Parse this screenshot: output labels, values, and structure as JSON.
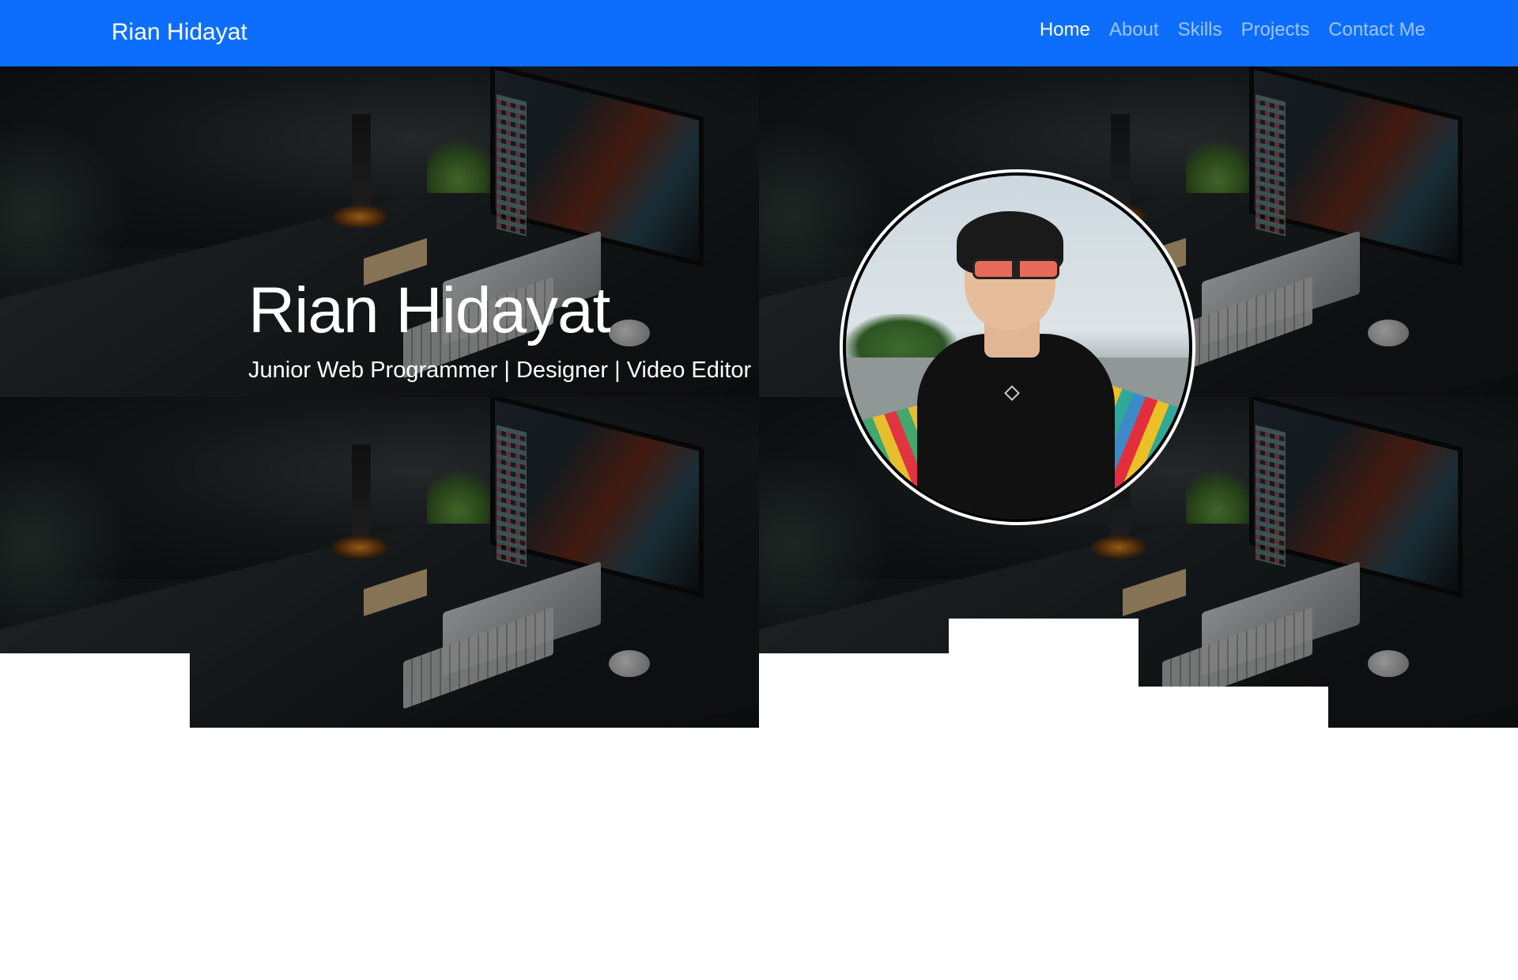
{
  "navbar": {
    "brand": "Rian Hidayat",
    "links": [
      {
        "label": "Home",
        "active": true
      },
      {
        "label": "About",
        "active": false
      },
      {
        "label": "Skills",
        "active": false
      },
      {
        "label": "Projects",
        "active": false
      },
      {
        "label": "Contact Me",
        "active": false
      }
    ],
    "background_color": "#0d6efd"
  },
  "hero": {
    "title": "Rian Hidayat",
    "subtitle": "Junior Web Programmer | Designer | Video Editor"
  },
  "profile_photo": {
    "icon": "profile-photo"
  }
}
